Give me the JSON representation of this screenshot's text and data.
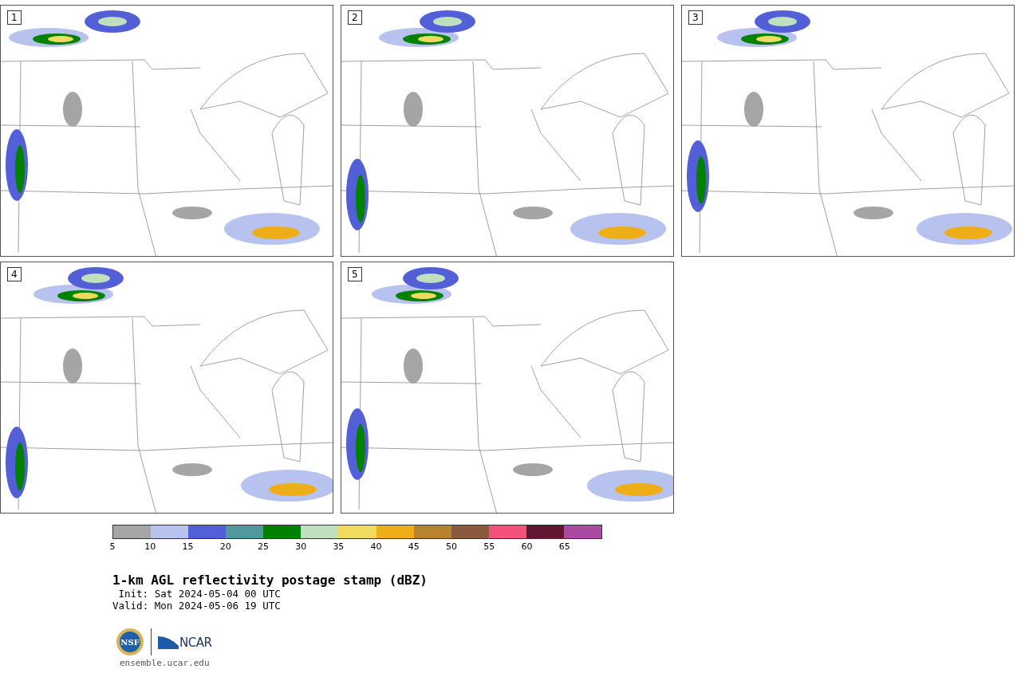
{
  "panels": [
    {
      "label": "1"
    },
    {
      "label": "2"
    },
    {
      "label": "3"
    },
    {
      "label": "4"
    },
    {
      "label": "5"
    }
  ],
  "colorbar": {
    "bins": [
      {
        "color": "#a5a5a5"
      },
      {
        "color": "#b8c2ee"
      },
      {
        "color": "#525fd7"
      },
      {
        "color": "#4f989b"
      },
      {
        "color": "#008200"
      },
      {
        "color": "#bfdfbf"
      },
      {
        "color": "#f0da60"
      },
      {
        "color": "#eeae18"
      },
      {
        "color": "#b8822f"
      },
      {
        "color": "#8b5a3c"
      },
      {
        "color": "#f4507c"
      },
      {
        "color": "#621632"
      },
      {
        "color": "#ab4aa4"
      }
    ],
    "ticks": [
      "5",
      "10",
      "15",
      "20",
      "25",
      "30",
      "35",
      "40",
      "45",
      "50",
      "55",
      "60",
      "65"
    ]
  },
  "title": "1-km AGL reflectivity postage stamp (dBZ)",
  "times": [
    {
      "label": "Init:",
      "value": "Sat 2024-05-04 00 UTC"
    },
    {
      "label": "Valid:",
      "value": "Mon 2024-05-06 19 UTC"
    }
  ],
  "logo": {
    "seal": "NSF",
    "name": "NCAR"
  },
  "footer": "ensemble.ucar.edu"
}
